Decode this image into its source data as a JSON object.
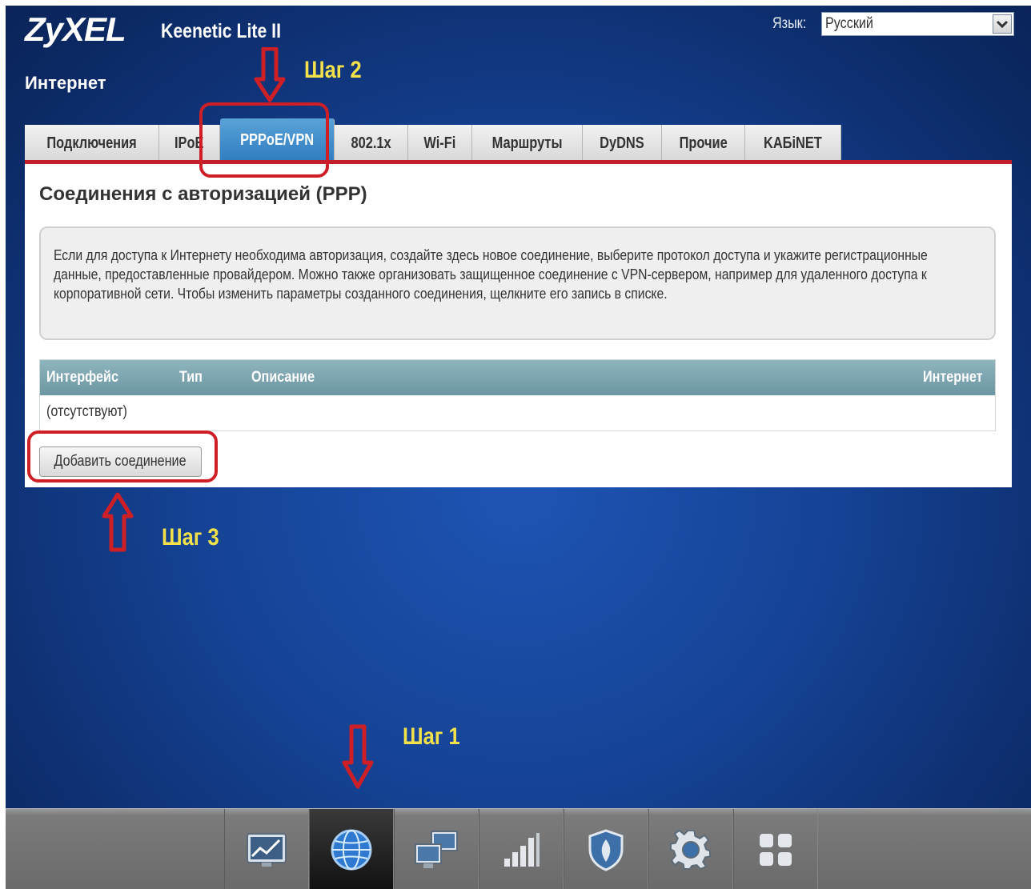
{
  "header": {
    "brand": "ZyXEL",
    "model": "Keenetic Lite II",
    "section_title": "Интернет",
    "language_label": "Язык:",
    "language_value": "Русский"
  },
  "tabs": [
    {
      "label": "Подключения",
      "active": false
    },
    {
      "label": "IPoE",
      "active": false
    },
    {
      "label": "PPPoE/VPN",
      "active": true
    },
    {
      "label": "802.1x",
      "active": false
    },
    {
      "label": "Wi-Fi",
      "active": false
    },
    {
      "label": "Маршруты",
      "active": false
    },
    {
      "label": "DyDNS",
      "active": false
    },
    {
      "label": "Прочие",
      "active": false
    },
    {
      "label": "KAБiNET",
      "active": false
    }
  ],
  "panel": {
    "heading": "Соединения с авторизацией (PPP)",
    "info_text": "Если для доступа к Интернету необходима авторизация, создайте здесь новое соединение, выберите протокол доступа и укажите регистрационные данные, предоставленные провайдером. Можно также организовать защищенное соединение с VPN-сервером, например для удаленного доступа к корпоративной сети. Чтобы изменить параметры созданного соединения, щелкните его запись в списке.",
    "table": {
      "columns": [
        "Интерфейс",
        "Тип",
        "Описание",
        "Интернет"
      ],
      "empty_text": "(отсутствуют)"
    },
    "add_button": "Добавить соединение"
  },
  "annotations": {
    "step1": "Шаг 1",
    "step2": "Шаг 2",
    "step3": "Шаг 3",
    "highlight_color": "#cf1f26",
    "label_color": "#f2e14a"
  },
  "bottom_nav": [
    {
      "icon": "monitor-chart-icon",
      "active": false
    },
    {
      "icon": "globe-icon",
      "active": true
    },
    {
      "icon": "network-computers-icon",
      "active": false
    },
    {
      "icon": "signal-bars-icon",
      "active": false
    },
    {
      "icon": "shield-icon",
      "active": false
    },
    {
      "icon": "gear-icon",
      "active": false
    },
    {
      "icon": "apps-grid-icon",
      "active": false
    }
  ],
  "colors": {
    "accent_red": "#c31f2a",
    "active_tab": "#2f7cc0",
    "background": "#154294"
  }
}
